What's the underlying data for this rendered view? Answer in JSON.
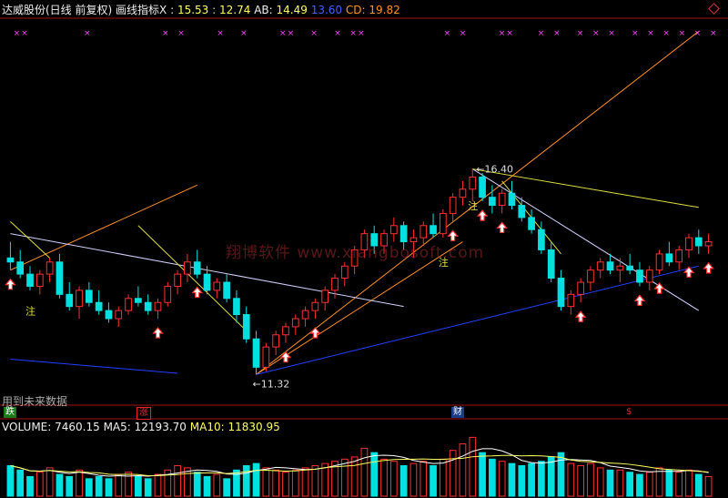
{
  "header": {
    "stock": "达威股份(日线 前复权)",
    "indicator_name": "画线指标X",
    "sep": ":",
    "v1": "15.53",
    "v2": "12.74",
    "ab_label": "AB:",
    "ab_value": "14.49",
    "v3": "13.60",
    "cd_label": "CD:",
    "cd_value": "19.82"
  },
  "watermark": "翔博软件 www.xiangbosoft.com",
  "future_text": "用到未来数据",
  "event_tags": [
    {
      "label": "跌",
      "color": "#22aa22"
    },
    {
      "label": "涨",
      "color": "#d22"
    },
    {
      "label": "财",
      "color": "#2266cc"
    },
    {
      "label": "$",
      "color": "#d22"
    }
  ],
  "volume_header": {
    "vol_label": "VOLUME:",
    "vol_value": "7460.15",
    "ma5_label": "MA5:",
    "ma5_value": "12193.70",
    "ma10_label": "MA10:",
    "ma10_value": "11830.95"
  },
  "colors": {
    "up": "#ff3030",
    "down": "#00e0e0",
    "orange": "#ff9020",
    "yellow": "#e0e040",
    "white_line": "#d0d0ff",
    "blue_line": "#2040ff",
    "magenta": "#ff40ff"
  },
  "chart_data": {
    "type": "candlestick",
    "annotations": {
      "high_label": "16.40",
      "low_label": "11.32",
      "note_char": "注"
    },
    "candles": [
      [
        14.2,
        14.6,
        13.9,
        14.1
      ],
      [
        14.1,
        14.4,
        13.7,
        13.8
      ],
      [
        13.8,
        14.0,
        13.4,
        13.5
      ],
      [
        13.5,
        13.9,
        13.3,
        13.8
      ],
      [
        13.8,
        14.2,
        13.6,
        14.1
      ],
      [
        14.1,
        14.3,
        13.2,
        13.3
      ],
      [
        13.3,
        13.6,
        12.9,
        13.0
      ],
      [
        13.0,
        13.5,
        12.7,
        13.4
      ],
      [
        13.4,
        13.6,
        13.0,
        13.1
      ],
      [
        13.1,
        13.4,
        12.8,
        12.9
      ],
      [
        12.9,
        13.1,
        12.6,
        12.7
      ],
      [
        12.7,
        13.0,
        12.5,
        12.9
      ],
      [
        12.9,
        13.3,
        12.8,
        13.2
      ],
      [
        13.2,
        13.5,
        13.0,
        13.1
      ],
      [
        13.1,
        13.3,
        12.8,
        12.9
      ],
      [
        12.9,
        13.2,
        12.7,
        13.1
      ],
      [
        13.1,
        13.6,
        13.0,
        13.5
      ],
      [
        13.5,
        13.9,
        13.3,
        13.8
      ],
      [
        13.8,
        14.3,
        13.6,
        14.1
      ],
      [
        14.1,
        14.4,
        13.7,
        13.8
      ],
      [
        13.8,
        14.0,
        13.3,
        13.4
      ],
      [
        13.4,
        13.7,
        13.2,
        13.6
      ],
      [
        13.6,
        13.8,
        13.1,
        13.2
      ],
      [
        13.2,
        13.4,
        12.6,
        12.8
      ],
      [
        12.8,
        13.0,
        12.1,
        12.2
      ],
      [
        12.2,
        12.4,
        11.32,
        11.5
      ],
      [
        11.5,
        12.1,
        11.4,
        12.0
      ],
      [
        12.0,
        12.4,
        11.8,
        12.3
      ],
      [
        12.3,
        12.6,
        12.1,
        12.5
      ],
      [
        12.5,
        12.8,
        12.3,
        12.7
      ],
      [
        12.7,
        13.0,
        12.5,
        12.9
      ],
      [
        12.9,
        13.2,
        12.7,
        13.1
      ],
      [
        13.1,
        13.5,
        12.9,
        13.4
      ],
      [
        13.4,
        13.8,
        13.2,
        13.7
      ],
      [
        13.7,
        14.1,
        13.5,
        14.0
      ],
      [
        14.0,
        14.5,
        13.8,
        14.4
      ],
      [
        14.4,
        14.9,
        14.2,
        14.8
      ],
      [
        14.8,
        15.0,
        14.3,
        14.5
      ],
      [
        14.5,
        14.9,
        14.3,
        14.8
      ],
      [
        14.8,
        15.2,
        14.6,
        15.0
      ],
      [
        15.0,
        15.1,
        14.4,
        14.6
      ],
      [
        14.6,
        14.9,
        14.2,
        14.7
      ],
      [
        14.7,
        15.1,
        14.5,
        15.0
      ],
      [
        15.0,
        15.3,
        14.7,
        14.8
      ],
      [
        14.8,
        15.4,
        14.7,
        15.3
      ],
      [
        15.3,
        15.8,
        15.1,
        15.7
      ],
      [
        15.7,
        16.1,
        15.5,
        15.9
      ],
      [
        15.9,
        16.4,
        15.6,
        16.2
      ],
      [
        16.2,
        16.3,
        15.6,
        15.7
      ],
      [
        15.7,
        16.0,
        15.3,
        15.5
      ],
      [
        15.5,
        15.9,
        15.3,
        15.8
      ],
      [
        15.8,
        16.1,
        15.4,
        15.5
      ],
      [
        15.5,
        15.7,
        15.1,
        15.2
      ],
      [
        15.2,
        15.4,
        14.8,
        14.9
      ],
      [
        14.9,
        15.1,
        14.3,
        14.4
      ],
      [
        14.4,
        14.6,
        13.6,
        13.7
      ],
      [
        13.7,
        13.9,
        12.9,
        13.0
      ],
      [
        13.0,
        13.4,
        12.8,
        13.3
      ],
      [
        13.3,
        13.7,
        13.1,
        13.6
      ],
      [
        13.6,
        14.0,
        13.4,
        13.9
      ],
      [
        13.9,
        14.2,
        13.7,
        14.1
      ],
      [
        14.1,
        14.3,
        13.8,
        13.9
      ],
      [
        13.9,
        14.2,
        13.6,
        14.0
      ],
      [
        14.0,
        14.3,
        13.8,
        13.9
      ],
      [
        13.9,
        14.1,
        13.5,
        13.6
      ],
      [
        13.6,
        14.0,
        13.4,
        13.9
      ],
      [
        13.9,
        14.4,
        13.8,
        14.3
      ],
      [
        14.3,
        14.6,
        14.0,
        14.1
      ],
      [
        14.1,
        14.5,
        13.9,
        14.4
      ],
      [
        14.4,
        14.8,
        14.2,
        14.7
      ],
      [
        14.7,
        14.9,
        14.3,
        14.5
      ],
      [
        14.5,
        14.8,
        14.3,
        14.6
      ]
    ],
    "volume": [
      14,
      12,
      9,
      11,
      13,
      10,
      9,
      12,
      8,
      9,
      8,
      10,
      11,
      9,
      8,
      10,
      12,
      14,
      13,
      11,
      9,
      10,
      8,
      12,
      14,
      15,
      13,
      12,
      11,
      12,
      13,
      14,
      15,
      16,
      17,
      18,
      22,
      20,
      17,
      16,
      14,
      15,
      16,
      14,
      17,
      21,
      24,
      27,
      20,
      17,
      16,
      15,
      14,
      15,
      16,
      18,
      20,
      15,
      14,
      15,
      13,
      12,
      12,
      11,
      10,
      11,
      13,
      12,
      11,
      12,
      10,
      9
    ]
  }
}
